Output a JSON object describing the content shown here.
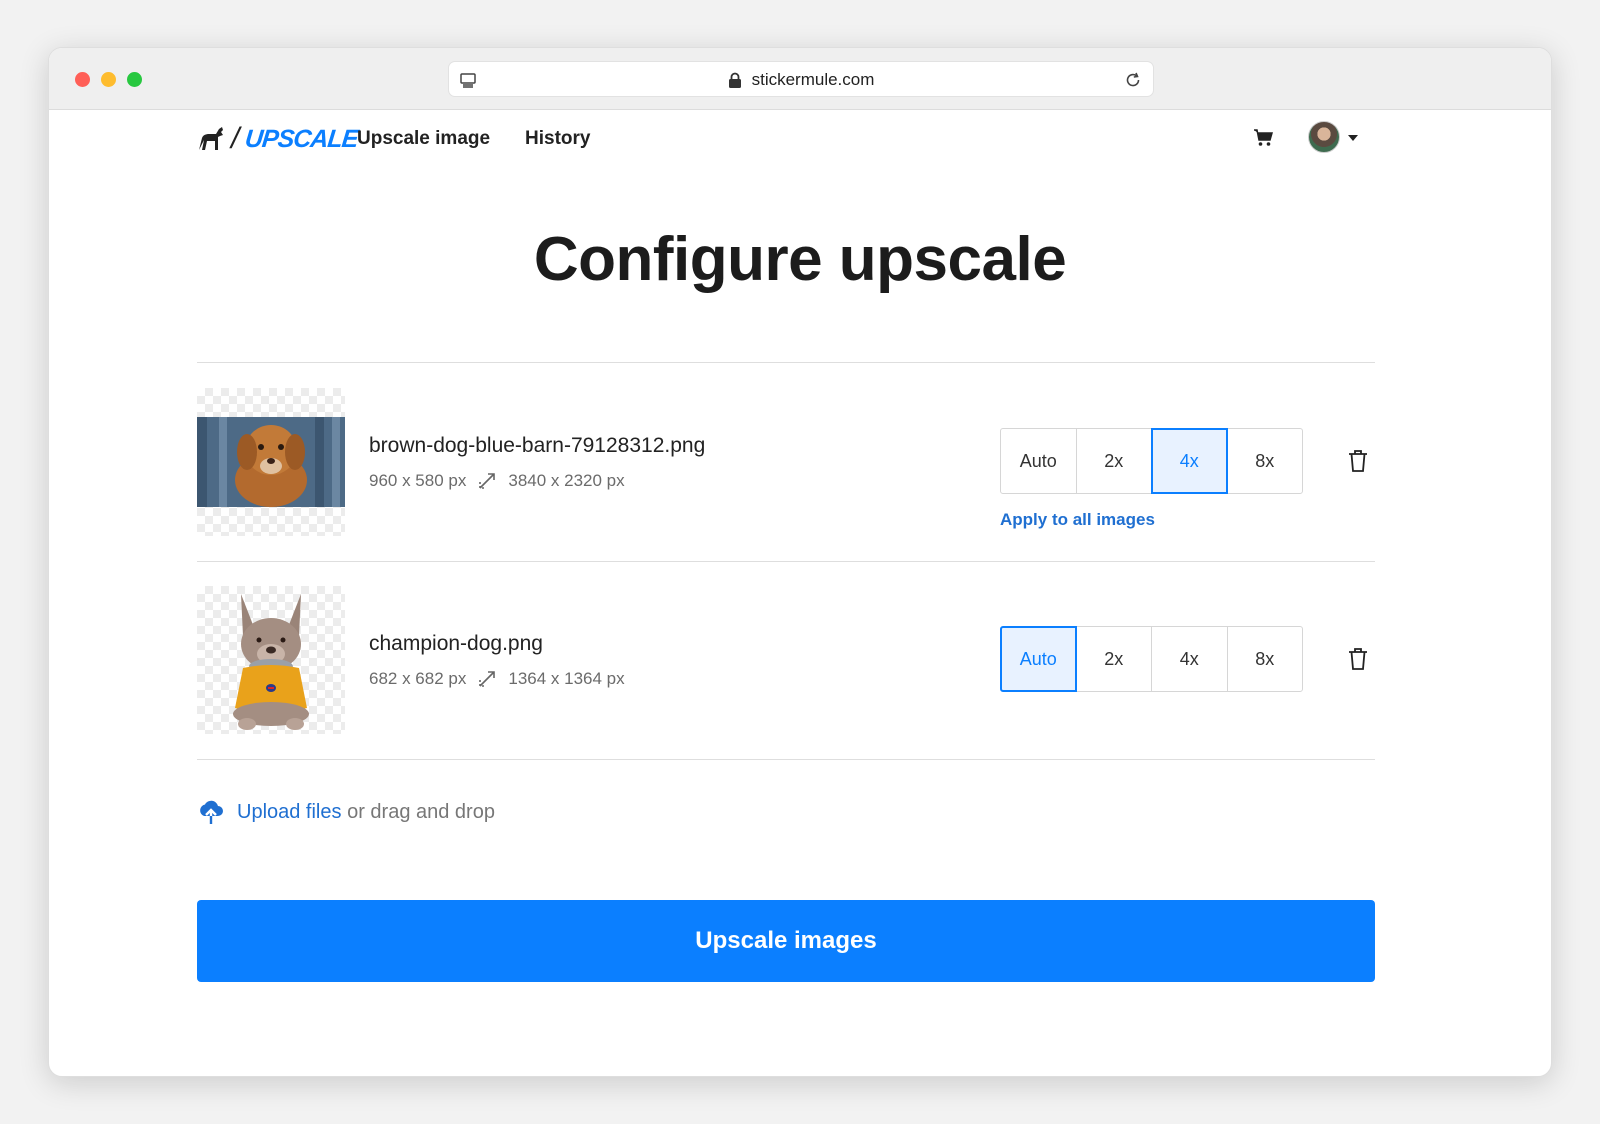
{
  "browser": {
    "url": "stickermule.com"
  },
  "nav": {
    "logo_text": "UPSCALE",
    "links": [
      "Upscale image",
      "History"
    ]
  },
  "page": {
    "title": "Configure upscale"
  },
  "images": [
    {
      "filename": "brown-dog-blue-barn-79128312.png",
      "original_size": "960 x 580 px",
      "upscaled_size": "3840 x 2320 px",
      "options": [
        "Auto",
        "2x",
        "4x",
        "8x"
      ],
      "selected": "4x",
      "apply_all_label": "Apply to all images"
    },
    {
      "filename": "champion-dog.png",
      "original_size": "682 x 682 px",
      "upscaled_size": "1364 x 1364 px",
      "options": [
        "Auto",
        "2x",
        "4x",
        "8x"
      ],
      "selected": "Auto"
    }
  ],
  "upload": {
    "link_label": "Upload files",
    "suffix": "or drag and drop"
  },
  "submit": {
    "label": "Upscale images"
  },
  "colors": {
    "accent": "#0b7fff",
    "link": "#1f6fd1"
  }
}
